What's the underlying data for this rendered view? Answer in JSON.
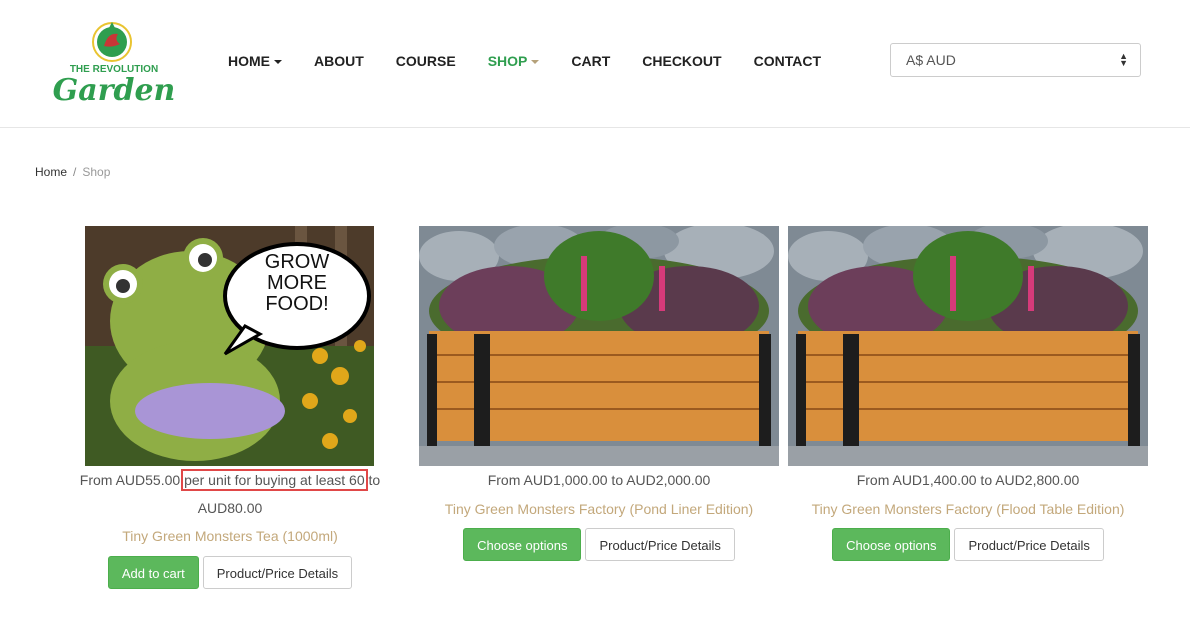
{
  "header": {
    "logo_top": "THE REVOLUTION",
    "logo_main": "Garden",
    "nav": [
      {
        "label": "HOME",
        "dropdown": true,
        "active": false
      },
      {
        "label": "ABOUT",
        "dropdown": false,
        "active": false
      },
      {
        "label": "COURSE",
        "dropdown": false,
        "active": false
      },
      {
        "label": "SHOP",
        "dropdown": true,
        "active": true
      },
      {
        "label": "CART",
        "dropdown": false,
        "active": false
      },
      {
        "label": "CHECKOUT",
        "dropdown": false,
        "active": false
      },
      {
        "label": "CONTACT",
        "dropdown": false,
        "active": false
      }
    ],
    "currency": "A$ AUD"
  },
  "breadcrumb": {
    "home": "Home",
    "separator": "/",
    "current": "Shop"
  },
  "products": [
    {
      "price_line1_prefix": "From AUD55.00",
      "price_line1_highlight": "per unit for buying at least 60",
      "price_line1_suffix": "to",
      "price_line2": "AUD80.00",
      "title": "Tiny Green Monsters Tea (1000ml)",
      "primary_button": "Add to cart",
      "secondary_button": "Product/Price Details",
      "image_text": [
        "GROW",
        "MORE",
        "FOOD!"
      ]
    },
    {
      "price_line1": "From AUD1,000.00 to AUD2,000.00",
      "title": "Tiny Green Monsters Factory (Pond Liner Edition)",
      "primary_button": "Choose options",
      "secondary_button": "Product/Price Details"
    },
    {
      "price_line1": "From AUD1,400.00 to AUD2,800.00",
      "title": "Tiny Green Monsters Factory (Flood Table Edition)",
      "primary_button": "Choose options",
      "secondary_button": "Product/Price Details"
    }
  ],
  "colors": {
    "brand_green": "#2f9e4f",
    "button_green": "#5cb85c",
    "title_tan": "#c3a87b",
    "highlight_red": "#e04848"
  }
}
